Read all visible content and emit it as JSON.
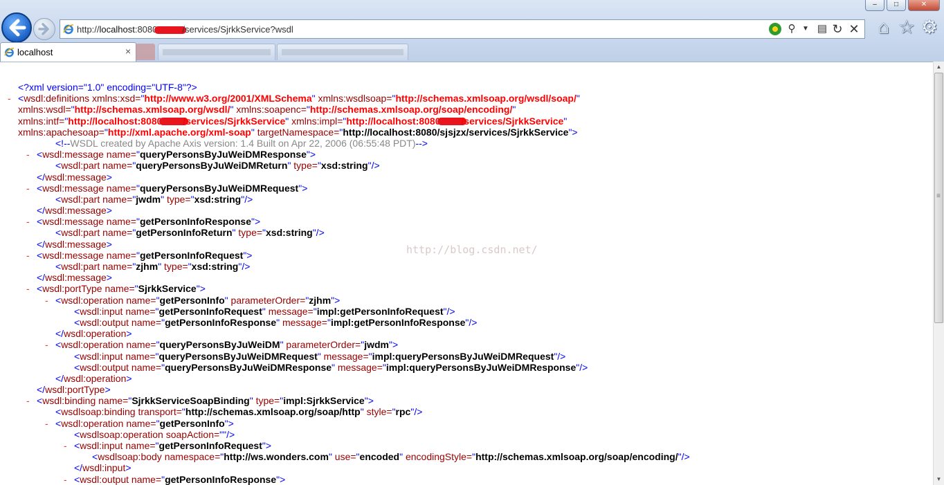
{
  "browser": {
    "address": {
      "prefix": "http://",
      "host": "localhost",
      "port": ":8080",
      "path": "/services/SjrkkService?wsdl"
    },
    "tab": {
      "title": "localhost",
      "close": "×"
    },
    "window_controls": {
      "minimize": "–",
      "maximize": "□",
      "close": "✕"
    }
  },
  "watermark": "http://blog.csdn.net/",
  "xml_lines": [
    {
      "indent": 0,
      "toggle": "",
      "segs": [
        [
          "pi",
          "<?xml version=\"1.0\" encoding=\"UTF-8\"?>"
        ]
      ]
    },
    {
      "indent": 0,
      "toggle": "-",
      "segs": [
        [
          "p",
          "<"
        ],
        [
          "t",
          "wsdl:definitions "
        ],
        [
          "an",
          "xmlns:xsd="
        ],
        [
          "p",
          "\""
        ],
        [
          "ns",
          "http://www.w3.org/2001/XMLSchema"
        ],
        [
          "p",
          "\" "
        ],
        [
          "an",
          "xmlns:wsdlsoap="
        ],
        [
          "p",
          "\""
        ],
        [
          "ns",
          "http://schemas.xmlsoap.org/wsdl/soap/"
        ],
        [
          "p",
          "\""
        ]
      ]
    },
    {
      "indent": 0,
      "toggle": "",
      "segs": [
        [
          "an",
          "xmlns:wsdl="
        ],
        [
          "p",
          "\""
        ],
        [
          "ns",
          "http://schemas.xmlsoap.org/wsdl/"
        ],
        [
          "p",
          "\" "
        ],
        [
          "an",
          "xmlns:soapenc="
        ],
        [
          "p",
          "\""
        ],
        [
          "ns",
          "http://schemas.xmlsoap.org/soap/encoding/"
        ],
        [
          "p",
          "\""
        ]
      ]
    },
    {
      "indent": 0,
      "toggle": "",
      "redact": true,
      "segs": [
        [
          "an",
          "xmlns:intf="
        ],
        [
          "p",
          "\""
        ],
        [
          "ns",
          "http://localhost:8080/"
        ],
        [
          "redact",
          ""
        ],
        [
          "ns",
          "/services/SjrkkService"
        ],
        [
          "p",
          "\" "
        ],
        [
          "an",
          "xmlns:impl="
        ],
        [
          "p",
          "\""
        ],
        [
          "ns",
          "http://localhost:8080/"
        ],
        [
          "redact",
          ""
        ],
        [
          "ns",
          "/services/SjrkkService"
        ],
        [
          "p",
          "\""
        ]
      ]
    },
    {
      "indent": 0,
      "toggle": "",
      "segs": [
        [
          "an",
          "xmlns:apachesoap="
        ],
        [
          "p",
          "\""
        ],
        [
          "ns",
          "http://xml.apache.org/xml-soap"
        ],
        [
          "p",
          "\" "
        ],
        [
          "an",
          "targetNamespace="
        ],
        [
          "p",
          "\""
        ],
        [
          "av",
          "http://localhost:8080/sjsjzx/services/SjrkkService"
        ],
        [
          "p",
          "\">"
        ]
      ]
    },
    {
      "indent": 2,
      "toggle": "",
      "segs": [
        [
          "p",
          "<!--"
        ],
        [
          "cm",
          "WSDL created by Apache Axis version: 1.4 Built on Apr 22, 2006 (06:55:48 PDT)"
        ],
        [
          "p",
          "-->"
        ]
      ]
    },
    {
      "indent": 1,
      "toggle": "-",
      "segs": [
        [
          "p",
          "<"
        ],
        [
          "t",
          "wsdl:message "
        ],
        [
          "an",
          "name="
        ],
        [
          "p",
          "\""
        ],
        [
          "av",
          "queryPersonsByJuWeiDMResponse"
        ],
        [
          "p",
          "\">"
        ]
      ]
    },
    {
      "indent": 2,
      "toggle": "",
      "segs": [
        [
          "p",
          "<"
        ],
        [
          "t",
          "wsdl:part "
        ],
        [
          "an",
          "name="
        ],
        [
          "p",
          "\""
        ],
        [
          "av",
          "queryPersonsByJuWeiDMReturn"
        ],
        [
          "p",
          "\" "
        ],
        [
          "an",
          "type="
        ],
        [
          "p",
          "\""
        ],
        [
          "av",
          "xsd:string"
        ],
        [
          "p",
          "\"/>"
        ]
      ]
    },
    {
      "indent": 1,
      "toggle": "",
      "segs": [
        [
          "p",
          "</"
        ],
        [
          "t",
          "wsdl:message"
        ],
        [
          "p",
          ">"
        ]
      ]
    },
    {
      "indent": 1,
      "toggle": "-",
      "segs": [
        [
          "p",
          "<"
        ],
        [
          "t",
          "wsdl:message "
        ],
        [
          "an",
          "name="
        ],
        [
          "p",
          "\""
        ],
        [
          "av",
          "queryPersonsByJuWeiDMRequest"
        ],
        [
          "p",
          "\">"
        ]
      ]
    },
    {
      "indent": 2,
      "toggle": "",
      "segs": [
        [
          "p",
          "<"
        ],
        [
          "t",
          "wsdl:part "
        ],
        [
          "an",
          "name="
        ],
        [
          "p",
          "\""
        ],
        [
          "av",
          "jwdm"
        ],
        [
          "p",
          "\" "
        ],
        [
          "an",
          "type="
        ],
        [
          "p",
          "\""
        ],
        [
          "av",
          "xsd:string"
        ],
        [
          "p",
          "\"/>"
        ]
      ]
    },
    {
      "indent": 1,
      "toggle": "",
      "segs": [
        [
          "p",
          "</"
        ],
        [
          "t",
          "wsdl:message"
        ],
        [
          "p",
          ">"
        ]
      ]
    },
    {
      "indent": 1,
      "toggle": "-",
      "segs": [
        [
          "p",
          "<"
        ],
        [
          "t",
          "wsdl:message "
        ],
        [
          "an",
          "name="
        ],
        [
          "p",
          "\""
        ],
        [
          "av",
          "getPersonInfoResponse"
        ],
        [
          "p",
          "\">"
        ]
      ]
    },
    {
      "indent": 2,
      "toggle": "",
      "segs": [
        [
          "p",
          "<"
        ],
        [
          "t",
          "wsdl:part "
        ],
        [
          "an",
          "name="
        ],
        [
          "p",
          "\""
        ],
        [
          "av",
          "getPersonInfoReturn"
        ],
        [
          "p",
          "\" "
        ],
        [
          "an",
          "type="
        ],
        [
          "p",
          "\""
        ],
        [
          "av",
          "xsd:string"
        ],
        [
          "p",
          "\"/>"
        ]
      ]
    },
    {
      "indent": 1,
      "toggle": "",
      "segs": [
        [
          "p",
          "</"
        ],
        [
          "t",
          "wsdl:message"
        ],
        [
          "p",
          ">"
        ]
      ]
    },
    {
      "indent": 1,
      "toggle": "-",
      "segs": [
        [
          "p",
          "<"
        ],
        [
          "t",
          "wsdl:message "
        ],
        [
          "an",
          "name="
        ],
        [
          "p",
          "\""
        ],
        [
          "av",
          "getPersonInfoRequest"
        ],
        [
          "p",
          "\">"
        ]
      ]
    },
    {
      "indent": 2,
      "toggle": "",
      "segs": [
        [
          "p",
          "<"
        ],
        [
          "t",
          "wsdl:part "
        ],
        [
          "an",
          "name="
        ],
        [
          "p",
          "\""
        ],
        [
          "av",
          "zjhm"
        ],
        [
          "p",
          "\" "
        ],
        [
          "an",
          "type="
        ],
        [
          "p",
          "\""
        ],
        [
          "av",
          "xsd:string"
        ],
        [
          "p",
          "\"/>"
        ]
      ]
    },
    {
      "indent": 1,
      "toggle": "",
      "segs": [
        [
          "p",
          "</"
        ],
        [
          "t",
          "wsdl:message"
        ],
        [
          "p",
          ">"
        ]
      ]
    },
    {
      "indent": 1,
      "toggle": "-",
      "segs": [
        [
          "p",
          "<"
        ],
        [
          "t",
          "wsdl:portType "
        ],
        [
          "an",
          "name="
        ],
        [
          "p",
          "\""
        ],
        [
          "av",
          "SjrkkService"
        ],
        [
          "p",
          "\">"
        ]
      ]
    },
    {
      "indent": 2,
      "toggle": "-",
      "segs": [
        [
          "p",
          "<"
        ],
        [
          "t",
          "wsdl:operation "
        ],
        [
          "an",
          "name="
        ],
        [
          "p",
          "\""
        ],
        [
          "av",
          "getPersonInfo"
        ],
        [
          "p",
          "\" "
        ],
        [
          "an",
          "parameterOrder="
        ],
        [
          "p",
          "\""
        ],
        [
          "av",
          "zjhm"
        ],
        [
          "p",
          "\">"
        ]
      ]
    },
    {
      "indent": 3,
      "toggle": "",
      "segs": [
        [
          "p",
          "<"
        ],
        [
          "t",
          "wsdl:input "
        ],
        [
          "an",
          "name="
        ],
        [
          "p",
          "\""
        ],
        [
          "av",
          "getPersonInfoRequest"
        ],
        [
          "p",
          "\" "
        ],
        [
          "an",
          "message="
        ],
        [
          "p",
          "\""
        ],
        [
          "av",
          "impl:getPersonInfoRequest"
        ],
        [
          "p",
          "\"/>"
        ]
      ]
    },
    {
      "indent": 3,
      "toggle": "",
      "segs": [
        [
          "p",
          "<"
        ],
        [
          "t",
          "wsdl:output "
        ],
        [
          "an",
          "name="
        ],
        [
          "p",
          "\""
        ],
        [
          "av",
          "getPersonInfoResponse"
        ],
        [
          "p",
          "\" "
        ],
        [
          "an",
          "message="
        ],
        [
          "p",
          "\""
        ],
        [
          "av",
          "impl:getPersonInfoResponse"
        ],
        [
          "p",
          "\"/>"
        ]
      ]
    },
    {
      "indent": 2,
      "toggle": "",
      "segs": [
        [
          "p",
          "</"
        ],
        [
          "t",
          "wsdl:operation"
        ],
        [
          "p",
          ">"
        ]
      ]
    },
    {
      "indent": 2,
      "toggle": "-",
      "segs": [
        [
          "p",
          "<"
        ],
        [
          "t",
          "wsdl:operation "
        ],
        [
          "an",
          "name="
        ],
        [
          "p",
          "\""
        ],
        [
          "av",
          "queryPersonsByJuWeiDM"
        ],
        [
          "p",
          "\" "
        ],
        [
          "an",
          "parameterOrder="
        ],
        [
          "p",
          "\""
        ],
        [
          "av",
          "jwdm"
        ],
        [
          "p",
          "\">"
        ]
      ]
    },
    {
      "indent": 3,
      "toggle": "",
      "segs": [
        [
          "p",
          "<"
        ],
        [
          "t",
          "wsdl:input "
        ],
        [
          "an",
          "name="
        ],
        [
          "p",
          "\""
        ],
        [
          "av",
          "queryPersonsByJuWeiDMRequest"
        ],
        [
          "p",
          "\" "
        ],
        [
          "an",
          "message="
        ],
        [
          "p",
          "\""
        ],
        [
          "av",
          "impl:queryPersonsByJuWeiDMRequest"
        ],
        [
          "p",
          "\"/>"
        ]
      ]
    },
    {
      "indent": 3,
      "toggle": "",
      "segs": [
        [
          "p",
          "<"
        ],
        [
          "t",
          "wsdl:output "
        ],
        [
          "an",
          "name="
        ],
        [
          "p",
          "\""
        ],
        [
          "av",
          "queryPersonsByJuWeiDMResponse"
        ],
        [
          "p",
          "\" "
        ],
        [
          "an",
          "message="
        ],
        [
          "p",
          "\""
        ],
        [
          "av",
          "impl:queryPersonsByJuWeiDMResponse"
        ],
        [
          "p",
          "\"/>"
        ]
      ]
    },
    {
      "indent": 2,
      "toggle": "",
      "segs": [
        [
          "p",
          "</"
        ],
        [
          "t",
          "wsdl:operation"
        ],
        [
          "p",
          ">"
        ]
      ]
    },
    {
      "indent": 1,
      "toggle": "",
      "segs": [
        [
          "p",
          "</"
        ],
        [
          "t",
          "wsdl:portType"
        ],
        [
          "p",
          ">"
        ]
      ]
    },
    {
      "indent": 1,
      "toggle": "-",
      "segs": [
        [
          "p",
          "<"
        ],
        [
          "t",
          "wsdl:binding "
        ],
        [
          "an",
          "name="
        ],
        [
          "p",
          "\""
        ],
        [
          "av",
          "SjrkkServiceSoapBinding"
        ],
        [
          "p",
          "\" "
        ],
        [
          "an",
          "type="
        ],
        [
          "p",
          "\""
        ],
        [
          "av",
          "impl:SjrkkService"
        ],
        [
          "p",
          "\">"
        ]
      ]
    },
    {
      "indent": 2,
      "toggle": "",
      "segs": [
        [
          "p",
          "<"
        ],
        [
          "t",
          "wsdlsoap:binding "
        ],
        [
          "an",
          "transport="
        ],
        [
          "p",
          "\""
        ],
        [
          "av",
          "http://schemas.xmlsoap.org/soap/http"
        ],
        [
          "p",
          "\" "
        ],
        [
          "an",
          "style="
        ],
        [
          "p",
          "\""
        ],
        [
          "av",
          "rpc"
        ],
        [
          "p",
          "\"/>"
        ]
      ]
    },
    {
      "indent": 2,
      "toggle": "-",
      "segs": [
        [
          "p",
          "<"
        ],
        [
          "t",
          "wsdl:operation "
        ],
        [
          "an",
          "name="
        ],
        [
          "p",
          "\""
        ],
        [
          "av",
          "getPersonInfo"
        ],
        [
          "p",
          "\">"
        ]
      ]
    },
    {
      "indent": 3,
      "toggle": "",
      "segs": [
        [
          "p",
          "<"
        ],
        [
          "t",
          "wsdlsoap:operation "
        ],
        [
          "an",
          "soapAction="
        ],
        [
          "p",
          "\"\"/>"
        ]
      ]
    },
    {
      "indent": 3,
      "toggle": "-",
      "segs": [
        [
          "p",
          "<"
        ],
        [
          "t",
          "wsdl:input "
        ],
        [
          "an",
          "name="
        ],
        [
          "p",
          "\""
        ],
        [
          "av",
          "getPersonInfoRequest"
        ],
        [
          "p",
          "\">"
        ]
      ]
    },
    {
      "indent": 4,
      "toggle": "",
      "segs": [
        [
          "p",
          "<"
        ],
        [
          "t",
          "wsdlsoap:body "
        ],
        [
          "an",
          "namespace="
        ],
        [
          "p",
          "\""
        ],
        [
          "av",
          "http://ws.wonders.com"
        ],
        [
          "p",
          "\" "
        ],
        [
          "an",
          "use="
        ],
        [
          "p",
          "\""
        ],
        [
          "av",
          "encoded"
        ],
        [
          "p",
          "\" "
        ],
        [
          "an",
          "encodingStyle="
        ],
        [
          "p",
          "\""
        ],
        [
          "av",
          "http://schemas.xmlsoap.org/soap/encoding/"
        ],
        [
          "p",
          "\"/>"
        ]
      ]
    },
    {
      "indent": 3,
      "toggle": "",
      "segs": [
        [
          "p",
          "</"
        ],
        [
          "t",
          "wsdl:input"
        ],
        [
          "p",
          ">"
        ]
      ]
    },
    {
      "indent": 3,
      "toggle": "-",
      "segs": [
        [
          "p",
          "<"
        ],
        [
          "t",
          "wsdl:output "
        ],
        [
          "an",
          "name="
        ],
        [
          "p",
          "\""
        ],
        [
          "av",
          "getPersonInfoResponse"
        ],
        [
          "p",
          "\">"
        ]
      ]
    }
  ]
}
